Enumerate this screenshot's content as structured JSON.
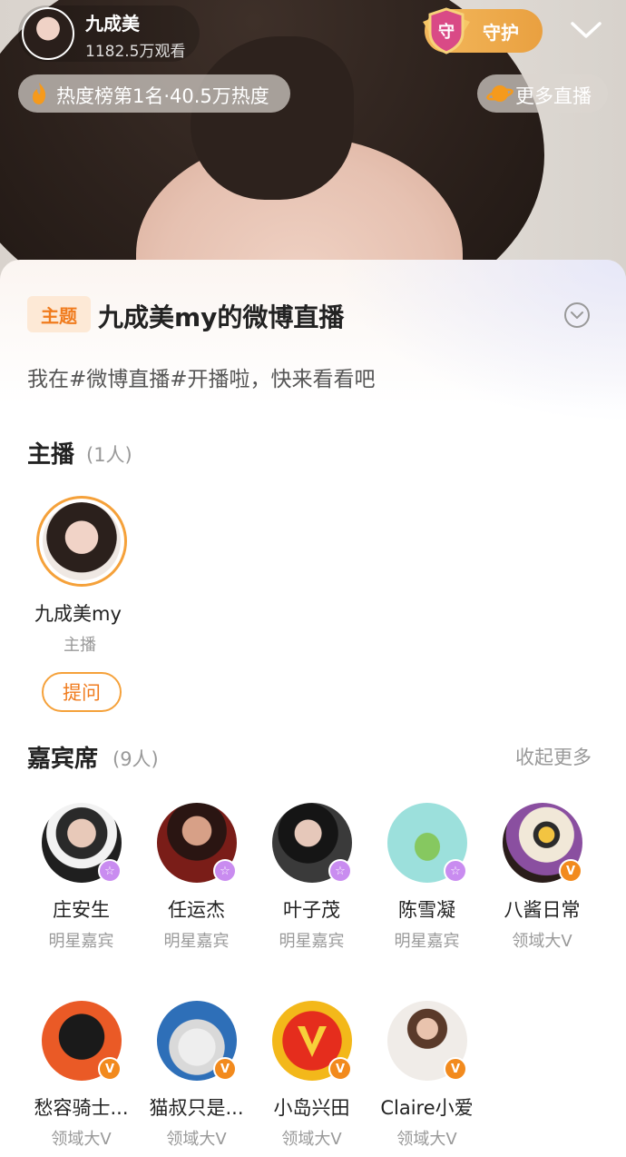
{
  "header": {
    "anchor_name": "九成美",
    "views": "1182.5万观看",
    "guard_label": "守护",
    "heat_text": "热度榜第1名·40.5万热度",
    "more_live": "更多直播"
  },
  "sheet": {
    "topic_tag": "主题",
    "title": "九成美my的微博直播",
    "description": "我在#微博直播#开播啦，快来看看吧"
  },
  "hosts": {
    "title": "主播",
    "count": "(1人)",
    "items": [
      {
        "name": "九成美my",
        "role": "主播"
      }
    ],
    "ask_label": "提问"
  },
  "guests": {
    "title": "嘉宾席",
    "count": "(9人)",
    "collapse_label": "收起更多",
    "items": [
      {
        "name": "庄安生",
        "role": "明星嘉宾",
        "badge": "star",
        "badge_glyph": "☆"
      },
      {
        "name": "任运杰",
        "role": "明星嘉宾",
        "badge": "star",
        "badge_glyph": "☆"
      },
      {
        "name": "叶子茂",
        "role": "明星嘉宾",
        "badge": "star",
        "badge_glyph": "☆"
      },
      {
        "name": "陈雪凝",
        "role": "明星嘉宾",
        "badge": "star",
        "badge_glyph": "☆"
      },
      {
        "name": "八酱日常",
        "role": "领域大V",
        "badge": "v",
        "badge_glyph": "V"
      },
      {
        "name": "愁容骑士...",
        "role": "领域大V",
        "badge": "v",
        "badge_glyph": "V"
      },
      {
        "name": "猫叔只是...",
        "role": "领域大V",
        "badge": "v",
        "badge_glyph": "V"
      },
      {
        "name": "小岛兴田",
        "role": "领域大V",
        "badge": "v",
        "badge_glyph": "V"
      },
      {
        "name": "Claire小爱",
        "role": "领域大V",
        "badge": "v",
        "badge_glyph": "V"
      }
    ]
  },
  "colors": {
    "accent": "#f07b1d",
    "guard": "#e9a040",
    "star_badge": "#c98cf0",
    "v_badge": "#f28a1d"
  }
}
